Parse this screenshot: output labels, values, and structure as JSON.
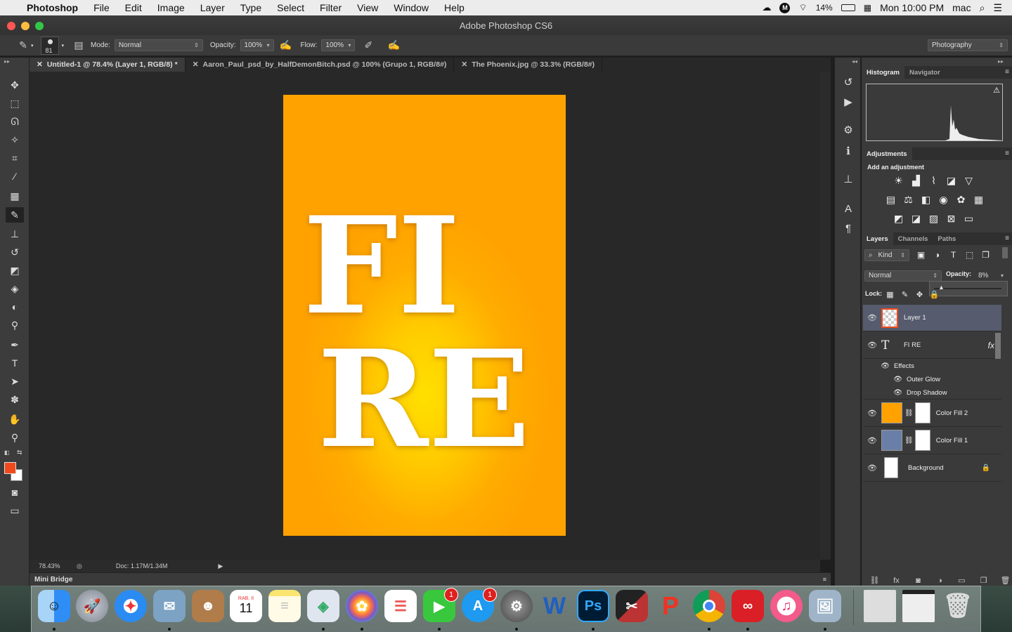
{
  "menubar": {
    "apple": "",
    "app_name": "Photoshop",
    "items": [
      "File",
      "Edit",
      "Image",
      "Layer",
      "Type",
      "Select",
      "Filter",
      "View",
      "Window",
      "Help"
    ],
    "battery": "14%",
    "datetime": "Mon 10:00 PM",
    "user": "mac"
  },
  "window": {
    "title": "Adobe Photoshop CS6"
  },
  "options": {
    "brush_size": "81",
    "mode_label": "Mode:",
    "mode_value": "Normal",
    "opacity_label": "Opacity:",
    "opacity_value": "100%",
    "flow_label": "Flow:",
    "flow_value": "100%",
    "workspace": "Photography"
  },
  "tabs": [
    {
      "label": "Untitled-1 @ 78.4% (Layer 1, RGB/8) *",
      "active": true
    },
    {
      "label": "Aaron_Paul_psd_by_HalfDemonBitch.psd @ 100% (Grupo 1, RGB/8#)",
      "active": false
    },
    {
      "label": "The Phoenix.jpg @ 33.3% (RGB/8#)",
      "active": false
    }
  ],
  "canvas": {
    "text_lines": [
      "FI",
      "RE"
    ],
    "bg_color": "#ffa200",
    "glow_color": "#ffe000"
  },
  "status": {
    "zoom": "78.43%",
    "doc": "Doc: 1.17M/1.34M"
  },
  "minibridge": {
    "label": "Mini Bridge"
  },
  "panels": {
    "histogram_tab": "Histogram",
    "navigator_tab": "Navigator",
    "adjustments_title": "Adjustments",
    "add_adjustment": "Add an adjustment",
    "layers_tab": "Layers",
    "channels_tab": "Channels",
    "paths_tab": "Paths",
    "kind_label": "Kind",
    "blend_mode": "Normal",
    "opacity_label": "Opacity:",
    "opacity_value": "8%",
    "lock_label": "Lock:"
  },
  "layers": [
    {
      "name": "Layer 1",
      "type": "pixel",
      "selected": true
    },
    {
      "name": "FI RE",
      "type": "text",
      "fx": "fx"
    },
    {
      "name": "Effects",
      "type": "effects-header"
    },
    {
      "name": "Outer Glow",
      "type": "effect"
    },
    {
      "name": "Drop Shadow",
      "type": "effect"
    },
    {
      "name": "Color Fill 2",
      "type": "fill",
      "color": "#ffa200"
    },
    {
      "name": "Color Fill 1",
      "type": "fill",
      "color": "#6a7fa8"
    },
    {
      "name": "Background",
      "type": "background"
    }
  ],
  "dock": {
    "calendar_month": "RAB. II",
    "calendar_day": "11",
    "facetime_badge": "1",
    "appstore_badge": "1"
  },
  "accent": "#f04a1c"
}
